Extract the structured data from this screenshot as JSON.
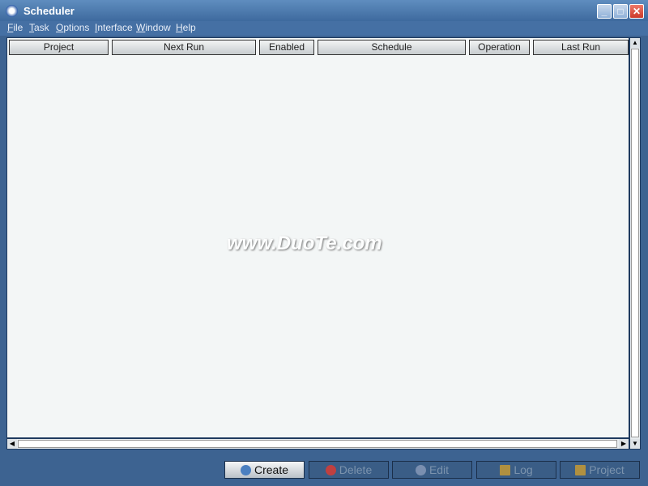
{
  "window": {
    "title": "Scheduler",
    "minimize_icon": "minimize-icon",
    "maximize_icon": "maximize-icon",
    "close_icon": "close-icon"
  },
  "menu": [
    "File",
    "Task",
    "Options",
    "Interface",
    "Window",
    "Help"
  ],
  "table": {
    "columns": [
      "Project",
      "Next Run",
      "Enabled",
      "Schedule",
      "Operation",
      "Last Run"
    ],
    "rows": []
  },
  "buttons": [
    {
      "label": "Create",
      "enabled": true
    },
    {
      "label": "Delete",
      "enabled": false
    },
    {
      "label": "Edit",
      "enabled": false
    },
    {
      "label": "Log",
      "enabled": false
    },
    {
      "label": "Project",
      "enabled": false
    }
  ],
  "watermark": "www.DuoTe.com",
  "colors": {
    "titlebar": "#4f7db2",
    "background": "#3d6391",
    "table_bg": "#f3f6f6",
    "close": "#d9453a"
  }
}
